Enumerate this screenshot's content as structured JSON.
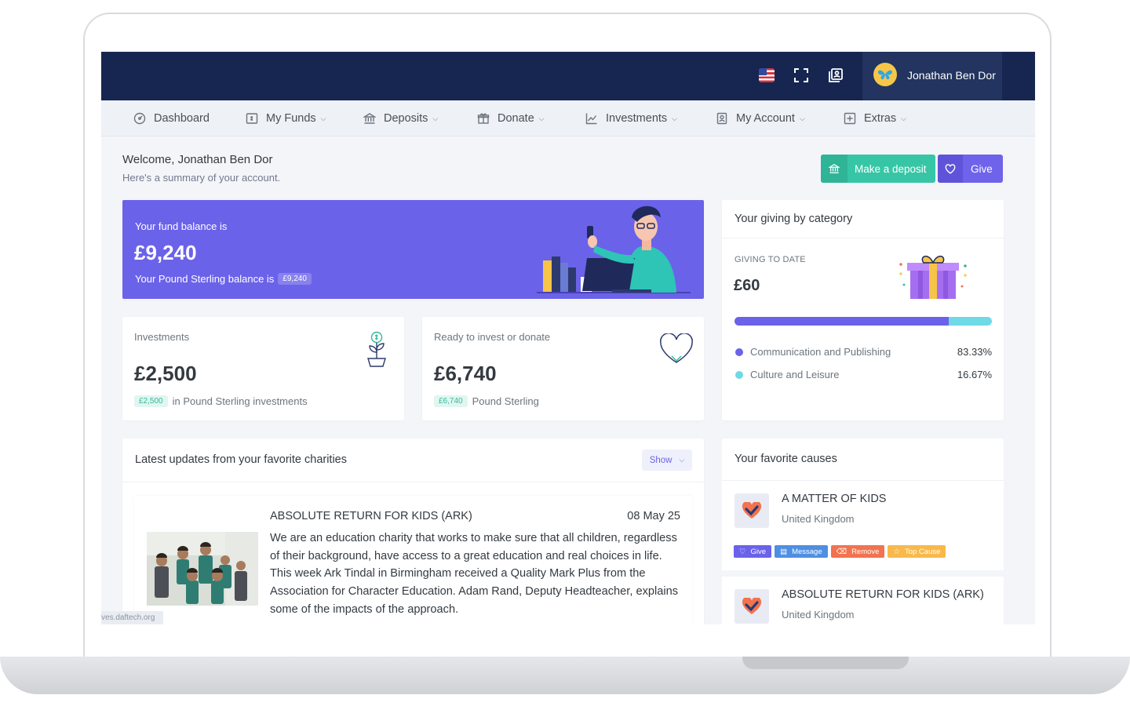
{
  "topbar": {
    "user_name": "Jonathan Ben Dor"
  },
  "nav": {
    "items": [
      {
        "label": "Dashboard"
      },
      {
        "label": "My Funds"
      },
      {
        "label": "Deposits"
      },
      {
        "label": "Donate"
      },
      {
        "label": "Investments"
      },
      {
        "label": "My Account"
      },
      {
        "label": "Extras"
      }
    ]
  },
  "welcome": {
    "title": "Welcome, Jonathan Ben Dor",
    "subtitle": "Here's a summary of your account."
  },
  "actions": {
    "deposit_label": "Make a deposit",
    "give_label": "Give"
  },
  "balance": {
    "label": "Your fund balance is",
    "amount": "£9,240",
    "sub_label": "Your Pound Sterling balance is",
    "badge": "£9,240"
  },
  "investments": {
    "label": "Investments",
    "amount": "£2,500",
    "badge": "£2,500",
    "sub": "in Pound Sterling investments"
  },
  "ready": {
    "label": "Ready to invest or donate",
    "amount": "£6,740",
    "badge": "£6,740",
    "sub": "Pound Sterling"
  },
  "giving": {
    "title": "Your giving by category",
    "label": "GIVING TO DATE",
    "amount": "£60",
    "categories": [
      {
        "name": "Communication and Publishing",
        "percent": "83.33%",
        "share": 0.8333,
        "color": "#6b62ea"
      },
      {
        "name": "Culture and Leisure",
        "percent": "16.67%",
        "share": 0.1667,
        "color": "#6fd9e6"
      }
    ]
  },
  "updates": {
    "title": "Latest updates from your favorite charities",
    "show_label": "Show",
    "item": {
      "charity": "ABSOLUTE RETURN FOR KIDS (ARK)",
      "date": "08 May 25",
      "text": "We are an education charity that works to make sure that all children, regardless of their background, have access to a great education and real choices in life. This week Ark Tindal in Birmingham received a Quality Mark Plus from the Association for Character Education. Adam Rand, Deputy Headteacher, explains some of the impacts of the approach."
    }
  },
  "causes": {
    "title": "Your favorite causes",
    "items": [
      {
        "name": "A MATTER OF KIDS",
        "country": "United Kingdom"
      },
      {
        "name": "ABSOLUTE RETURN FOR KIDS (ARK)",
        "country": "United Kingdom"
      }
    ],
    "actions": {
      "give": "Give",
      "message": "Message",
      "remove": "Remove",
      "top_cause": "Top Cause"
    }
  },
  "status_url": "ves.daftech.org",
  "colors": {
    "topbar": "#172650",
    "accent": "#6b62ea",
    "teal": "#36c6a6",
    "message": "#4d8fe3",
    "remove": "#f1734f",
    "top_cause": "#f8b94a"
  }
}
